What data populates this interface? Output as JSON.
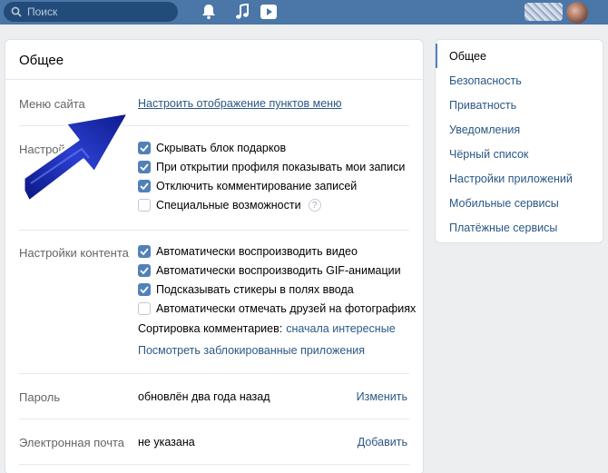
{
  "topbar": {
    "search_placeholder": "Поиск",
    "icons": [
      "search-icon",
      "bell-icon",
      "music-icon",
      "video-play-icon"
    ]
  },
  "main": {
    "title": "Общее",
    "site_menu": {
      "label": "Меню сайта",
      "link": "Настроить отображение пунктов меню"
    },
    "settings": {
      "label": "Настройки",
      "options": [
        {
          "label": "Скрывать блок подарков",
          "checked": true
        },
        {
          "label": "При открытии профиля показывать мои записи",
          "checked": true
        },
        {
          "label": "Отключить комментирование записей",
          "checked": true
        },
        {
          "label": "Специальные возможности",
          "checked": false,
          "help": "?"
        }
      ]
    },
    "content": {
      "label": "Настройки контента",
      "options": [
        {
          "label": "Автоматически воспроизводить видео",
          "checked": true
        },
        {
          "label": "Автоматически воспроизводить GIF-анимации",
          "checked": true
        },
        {
          "label": "Подсказывать стикеры в полях ввода",
          "checked": true
        },
        {
          "label": "Автоматически отмечать друзей на фотографиях",
          "checked": false
        }
      ],
      "sort_label": "Сортировка комментариев:",
      "sort_value": "сначала интересные",
      "blocked_apps_link": "Посмотреть заблокированные приложения"
    },
    "password": {
      "label": "Пароль",
      "value": "обновлён два года назад",
      "action": "Изменить"
    },
    "email": {
      "label": "Электронная почта",
      "value": "не указана",
      "action": "Добавить"
    }
  },
  "sidebar": {
    "items": [
      {
        "label": "Общее",
        "active": true
      },
      {
        "label": "Безопасность"
      },
      {
        "label": "Приватность"
      },
      {
        "label": "Уведомления"
      },
      {
        "label": "Чёрный список"
      },
      {
        "label": "Настройки приложений"
      },
      {
        "label": "Мобильные сервисы"
      },
      {
        "label": "Платёжные сервисы"
      }
    ]
  },
  "colors": {
    "header": "#4a76a8",
    "link": "#2a5885",
    "checkbox": "#5181b8",
    "arrow": "#1a2fa8"
  }
}
